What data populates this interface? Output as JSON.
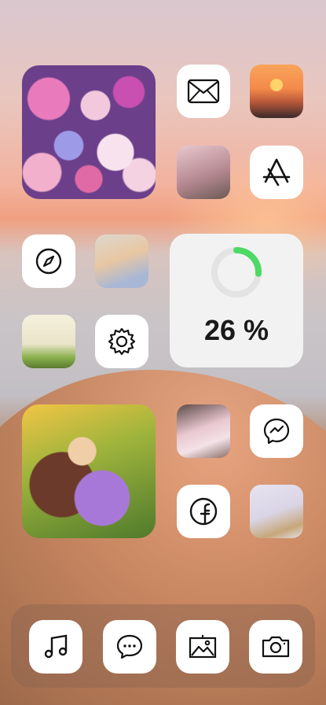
{
  "battery_widget": {
    "value_text": "26 %",
    "fraction": 0.26,
    "accent": "#4cd964",
    "track": "#e3e3e3"
  },
  "icons": {
    "mail": "mail-icon",
    "app_store": "app-store-icon",
    "compass": "compass-icon",
    "settings": "gear-icon",
    "messenger": "messenger-icon",
    "facebook": "facebook-icon",
    "music": "music-icon",
    "messages": "messages-icon",
    "photos": "photos-icon",
    "camera": "camera-icon"
  }
}
